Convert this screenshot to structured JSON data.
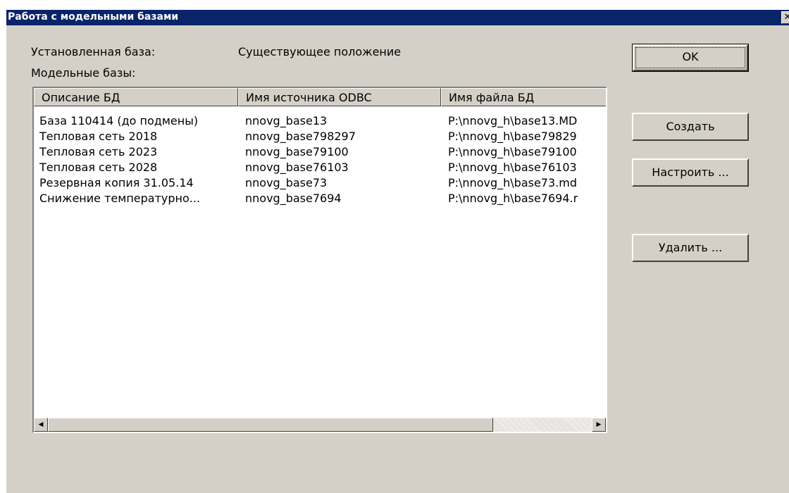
{
  "window": {
    "title": "Работа с модельными базами",
    "close_glyph": "✕"
  },
  "installed": {
    "label": "Установленная база:",
    "value": "Существующее положение"
  },
  "models_label": "Модельные базы:",
  "list": {
    "columns": [
      "Описание БД",
      "Имя источника ODBC",
      "Имя файла БД"
    ],
    "rows": [
      [
        "База 110414 (до подмены)",
        "nnovg_base13",
        "P:\\nnovg_h\\base13.MD"
      ],
      [
        "Тепловая сеть 2018",
        "nnovg_base798297",
        "P:\\nnovg_h\\base79829"
      ],
      [
        "Тепловая сеть 2023",
        "nnovg_base79100",
        "P:\\nnovg_h\\base79100"
      ],
      [
        "Тепловая сеть 2028",
        "nnovg_base76103",
        "P:\\nnovg_h\\base76103"
      ],
      [
        "Резервная копия 31.05.14",
        "nnovg_base73",
        "P:\\nnovg_h\\base73.md"
      ],
      [
        "Снижение температурно...",
        "nnovg_base7694",
        "P:\\nnovg_h\\base7694.r"
      ]
    ]
  },
  "buttons": {
    "ok": "OK",
    "create": "Создать",
    "configure": "Настроить ...",
    "delete": "Удалить ..."
  }
}
